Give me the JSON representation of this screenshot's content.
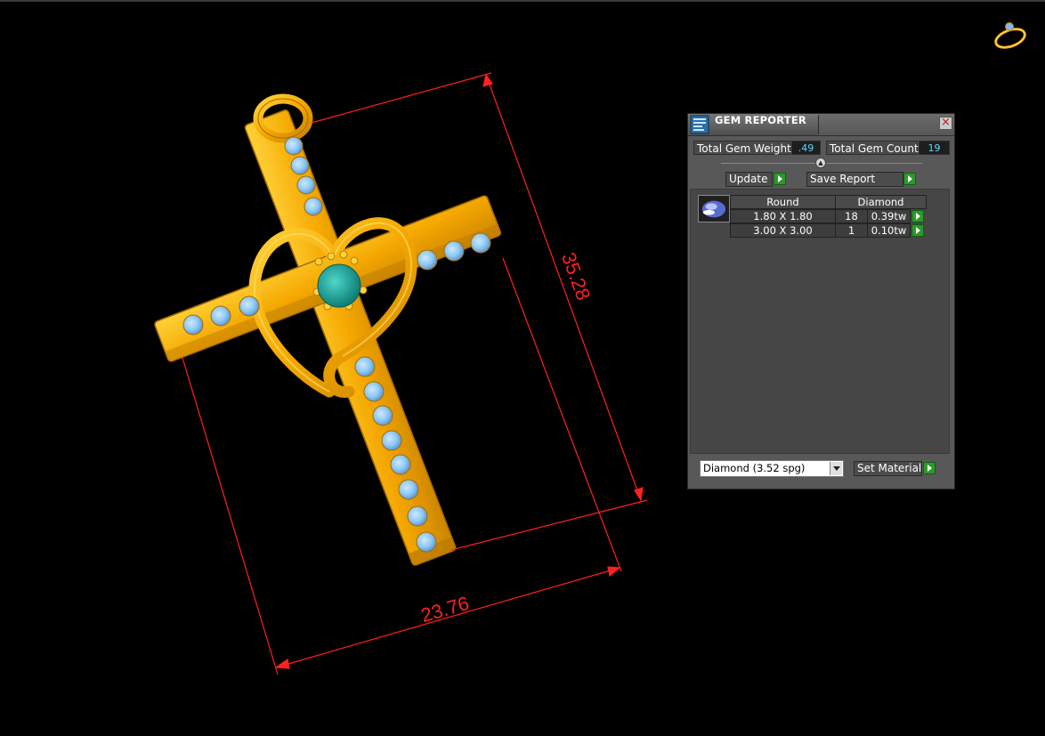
{
  "viewport": {
    "dimension_width": "23.76",
    "dimension_height": "35.28",
    "dimension_color": "#ff2020",
    "metal_color": "#f5a800",
    "stone_color": "#8ec9f5",
    "center_stone_color": "#1aa39a",
    "corner_icon": "ring-icon"
  },
  "gem_reporter": {
    "title": "GEM REPORTER",
    "title_icon": "report-icon",
    "total_gem_weight_label": "Total Gem Weight",
    "total_gem_weight_value": ".49",
    "total_gem_count_label": "Total Gem Count",
    "total_gem_count_value": "19",
    "update_label": "Update",
    "save_report_label": "Save Report",
    "table": {
      "shape_header": "Round",
      "material_header": "Diamond",
      "rows": [
        {
          "size": "1.80 X 1.80",
          "count": "18",
          "weight": "0.39tw"
        },
        {
          "size": "3.00 X 3.00",
          "count": "1",
          "weight": "0.10tw"
        }
      ]
    },
    "material_selected": "Diamond    (3.52 spg)",
    "set_material_label": "Set Material",
    "accent_color": "#2a9a28",
    "value_color": "#5fd6ff"
  }
}
